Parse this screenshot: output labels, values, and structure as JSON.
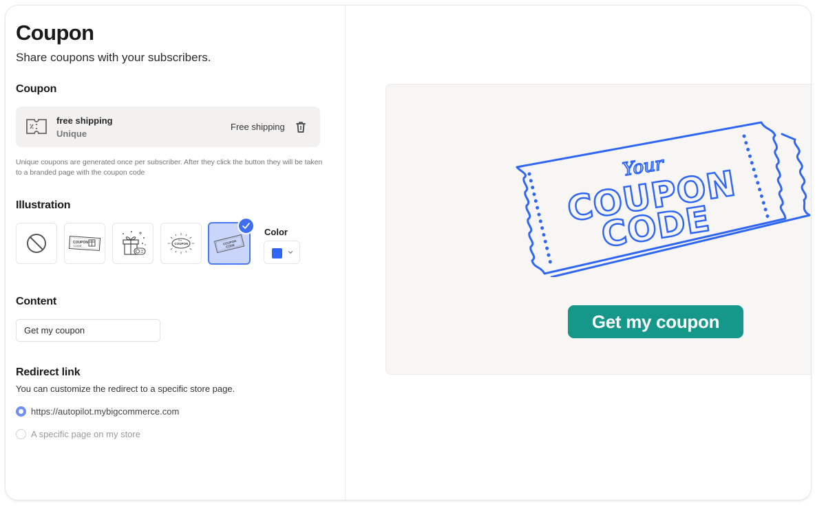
{
  "header": {
    "title": "Coupon",
    "subtitle": "Share coupons with your subscribers."
  },
  "coupon_section": {
    "title": "Coupon",
    "card": {
      "icon": "coupon-ticket-icon",
      "name": "free shipping",
      "type": "Unique",
      "value": "Free shipping",
      "delete_icon": "trash-icon"
    },
    "helper_text": "Unique coupons are generated once per subscriber. After they click the button they will be taken to a branded page with the coupon code"
  },
  "illustration_section": {
    "title": "Illustration",
    "options": [
      {
        "name": "none",
        "icon": "no-illustration-icon",
        "selected": false
      },
      {
        "name": "coupon-gift-ticket",
        "icon": "coupon-gift-ticket-illustration",
        "selected": false
      },
      {
        "name": "gift-box",
        "icon": "gift-box-illustration",
        "selected": false
      },
      {
        "name": "your-coupon-burst",
        "icon": "coupon-burst-illustration",
        "selected": false
      },
      {
        "name": "your-coupon-code-ticket",
        "icon": "coupon-code-ticket-illustration",
        "selected": true
      }
    ],
    "color": {
      "label": "Color",
      "value": "#2f66f6"
    }
  },
  "content_section": {
    "title": "Content",
    "button_text_value": "Get my coupon"
  },
  "redirect_section": {
    "title": "Redirect link",
    "description": "You can customize the redirect to a specific store page.",
    "options": [
      {
        "label": "https://autopilot.mybigcommerce.com",
        "checked": true
      },
      {
        "label": "A specific page on my store",
        "checked": false
      }
    ]
  },
  "preview": {
    "illustration_text": {
      "script": "Your",
      "line1": "COUPON",
      "line2": "CODE"
    },
    "button_label": "Get my coupon",
    "button_color": "#159789",
    "illustration_color": "#2f66f6"
  }
}
